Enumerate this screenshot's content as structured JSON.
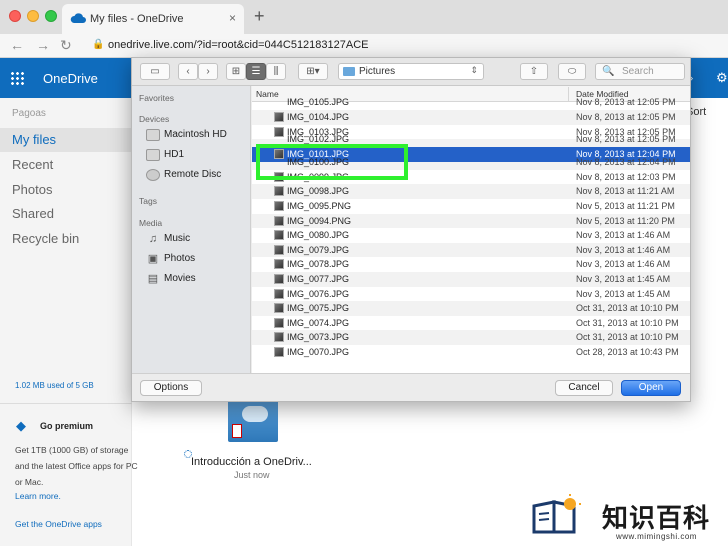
{
  "browser": {
    "tab_title": "My files - OneDrive",
    "tab_close": "×",
    "new_tab": "+",
    "url": "onedrive.live.com/?id=root&cid=044C512183127ACE",
    "lock_icon": "lock-icon"
  },
  "onedrive": {
    "brand": "OneDrive",
    "user_name": "Pagoas",
    "nav": [
      {
        "label": "My files",
        "active": true
      },
      {
        "label": "Recent"
      },
      {
        "label": "Photos"
      },
      {
        "label": "Shared"
      },
      {
        "label": "Recycle bin"
      }
    ],
    "storage": "1.02 MB used of 5 GB",
    "premium": {
      "title": "Go premium",
      "text": "Get 1TB (1000 GB) of storage and the latest Office apps for PC or Mac.",
      "learn_more": "Learn more.",
      "get_apps": "Get the OneDrive apps"
    },
    "sort_label": "Sort",
    "folder": {
      "name": "Introducción a OneDriv...",
      "modified": "Just now"
    },
    "colors": {
      "header": "#0f6cbd"
    }
  },
  "dialog": {
    "location": "Pictures",
    "search_placeholder": "Search",
    "sidebar": {
      "favorites_label": "Favorites",
      "devices_label": "Devices",
      "devices": [
        "Macintosh HD",
        "HD1",
        "Remote Disc"
      ],
      "tags_label": "Tags",
      "media_label": "Media",
      "media": [
        "Music",
        "Photos",
        "Movies"
      ]
    },
    "columns": {
      "name": "Name",
      "date": "Date Modified"
    },
    "files": [
      {
        "name": "IMG_0105.JPG",
        "date": "Nov 8, 2013 at 12:05 PM",
        "clipped": true
      },
      {
        "name": "IMG_0104.JPG",
        "date": "Nov 8, 2013 at 12:05 PM"
      },
      {
        "name": "IMG_0103.JPG",
        "date": "Nov 8, 2013 at 12:05 PM"
      },
      {
        "name": "IMG_0102.JPG",
        "date": "Nov 8, 2013 at 12:05 PM",
        "clipped": true
      },
      {
        "name": "IMG_0101.JPG",
        "date": "Nov 8, 2013 at 12:04 PM",
        "selected": true
      },
      {
        "name": "IMG_0100.JPG",
        "date": "Nov 8, 2013 at 12:04 PM",
        "clipped": true
      },
      {
        "name": "IMG_0099.JPG",
        "date": "Nov 8, 2013 at 12:03 PM"
      },
      {
        "name": "IMG_0098.JPG",
        "date": "Nov 8, 2013 at 11:21 AM"
      },
      {
        "name": "IMG_0095.PNG",
        "date": "Nov 5, 2013 at 11:21 PM"
      },
      {
        "name": "IMG_0094.PNG",
        "date": "Nov 5, 2013 at 11:20 PM"
      },
      {
        "name": "IMG_0080.JPG",
        "date": "Nov 3, 2013 at 1:46 AM"
      },
      {
        "name": "IMG_0079.JPG",
        "date": "Nov 3, 2013 at 1:46 AM"
      },
      {
        "name": "IMG_0078.JPG",
        "date": "Nov 3, 2013 at 1:46 AM"
      },
      {
        "name": "IMG_0077.JPG",
        "date": "Nov 3, 2013 at 1:45 AM"
      },
      {
        "name": "IMG_0076.JPG",
        "date": "Nov 3, 2013 at 1:45 AM"
      },
      {
        "name": "IMG_0075.JPG",
        "date": "Oct 31, 2013 at 10:10 PM"
      },
      {
        "name": "IMG_0074.JPG",
        "date": "Oct 31, 2013 at 10:10 PM"
      },
      {
        "name": "IMG_0073.JPG",
        "date": "Oct 31, 2013 at 10:10 PM"
      },
      {
        "name": "IMG_0070.JPG",
        "date": "Oct 28, 2013 at 10:43 PM"
      }
    ],
    "buttons": {
      "options": "Options",
      "cancel": "Cancel",
      "open": "Open"
    },
    "colors": {
      "selection": "#2461c8",
      "highlight_box": "#2ef02e"
    }
  },
  "watermark": {
    "title": "知识百科",
    "url": "www.mimingshi.com"
  }
}
